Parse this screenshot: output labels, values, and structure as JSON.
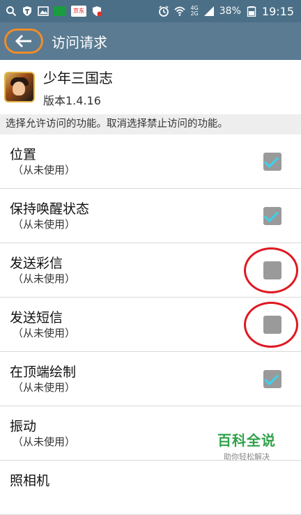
{
  "status_bar": {
    "icons": [
      "search-icon",
      "shield-icon",
      "image-icon",
      "iqiyi-app-icon",
      "jd-app-icon",
      "shield-notify-icon"
    ],
    "jd_label": "京东",
    "net_top": "4G",
    "net_bottom": "2G",
    "battery": "38%",
    "time": "19:15"
  },
  "app_bar": {
    "title": "访问请求"
  },
  "app": {
    "name": "少年三国志",
    "version": "版本1.4.16"
  },
  "hint": "选择允许访问的功能。取消选择禁止访问的功能。",
  "permissions": [
    {
      "title": "位置",
      "sub": "（从未使用）",
      "checked": true
    },
    {
      "title": "保持唤醒状态",
      "sub": "（从未使用）",
      "checked": true
    },
    {
      "title": "发送彩信",
      "sub": "（从未使用）",
      "checked": false
    },
    {
      "title": "发送短信",
      "sub": "（从未使用）",
      "checked": false
    },
    {
      "title": "在顶端绘制",
      "sub": "（从未使用）",
      "checked": true
    },
    {
      "title": "振动",
      "sub": "（从未使用）",
      "checked": false
    },
    {
      "title": "照相机",
      "sub": "",
      "checked": false
    }
  ],
  "watermark": {
    "main": "百科全说",
    "sub": "助你轻松解决"
  },
  "colors": {
    "status_bar": "#4b6f87",
    "app_bar": "#5a7b92",
    "annotation_orange": "#f28c28",
    "annotation_red": "#e01822",
    "check_tick": "#3ad2f0"
  }
}
